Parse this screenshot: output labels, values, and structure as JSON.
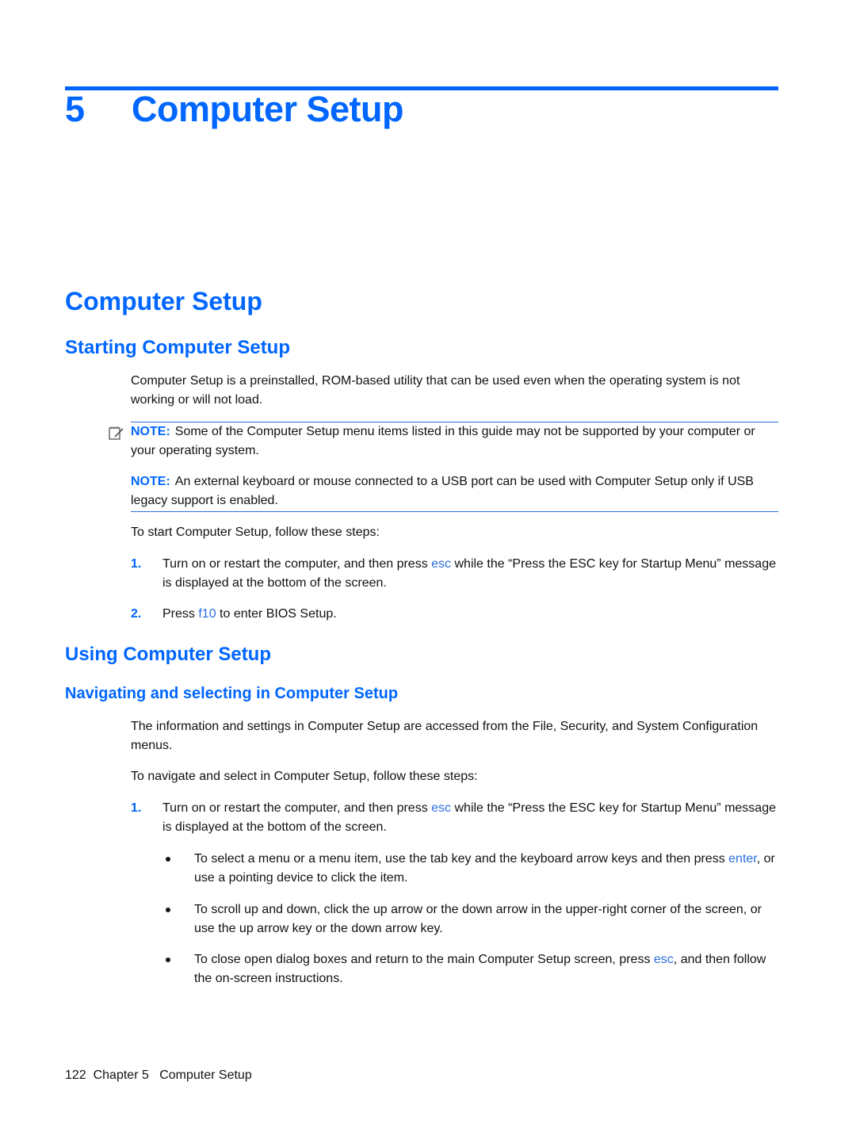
{
  "chapter": {
    "number": "5",
    "title": "Computer Setup"
  },
  "section_title": "Computer Setup",
  "starting": {
    "heading": "Starting Computer Setup",
    "intro": "Computer Setup is a preinstalled, ROM-based utility that can be used even when the operating system is not working or will not load.",
    "notes": [
      {
        "label": "NOTE:",
        "text": "Some of the Computer Setup menu items listed in this guide may not be supported by your computer or your operating system."
      },
      {
        "label": "NOTE:",
        "text": "An external keyboard or mouse connected to a USB port can be used with Computer Setup only if USB legacy support is enabled."
      }
    ],
    "steps_intro": "To start Computer Setup, follow these steps:",
    "steps": [
      {
        "num": "1.",
        "before": "Turn on or restart the computer, and then press ",
        "key": "esc",
        "after": " while the “Press the ESC key for Startup Menu” message is displayed at the bottom of the screen."
      },
      {
        "num": "2.",
        "before": "Press ",
        "key": "f10",
        "after": " to enter BIOS Setup."
      }
    ]
  },
  "using": {
    "heading": "Using Computer Setup",
    "subheading": "Navigating and selecting in Computer Setup",
    "intro": "The information and settings in Computer Setup are accessed from the File, Security, and System Configuration menus.",
    "steps_intro": "To navigate and select in Computer Setup, follow these steps:",
    "steps": [
      {
        "num": "1.",
        "before": "Turn on or restart the computer, and then press ",
        "key": "esc",
        "after": " while the “Press the ESC key for Startup Menu” message is displayed at the bottom of the screen."
      }
    ],
    "bullets": [
      {
        "before": "To select a menu or a menu item, use the tab key and the keyboard arrow keys and then press ",
        "key": "enter",
        "after": ", or use a pointing device to click the item."
      },
      {
        "before": "To scroll up and down, click the up arrow or the down arrow in the upper-right corner of the screen, or use the up arrow key or the down arrow key.",
        "key": "",
        "after": ""
      },
      {
        "before": "To close open dialog boxes and return to the main Computer Setup screen, press ",
        "key": "esc",
        "after": ", and then follow the on-screen instructions."
      }
    ]
  },
  "footer": {
    "page_number": "122",
    "chapter_label": "Chapter 5",
    "chapter_title": "Computer Setup"
  },
  "colors": {
    "accent": "#0066ff",
    "key_text": "#2a6ee0",
    "body_text": "#111111"
  }
}
